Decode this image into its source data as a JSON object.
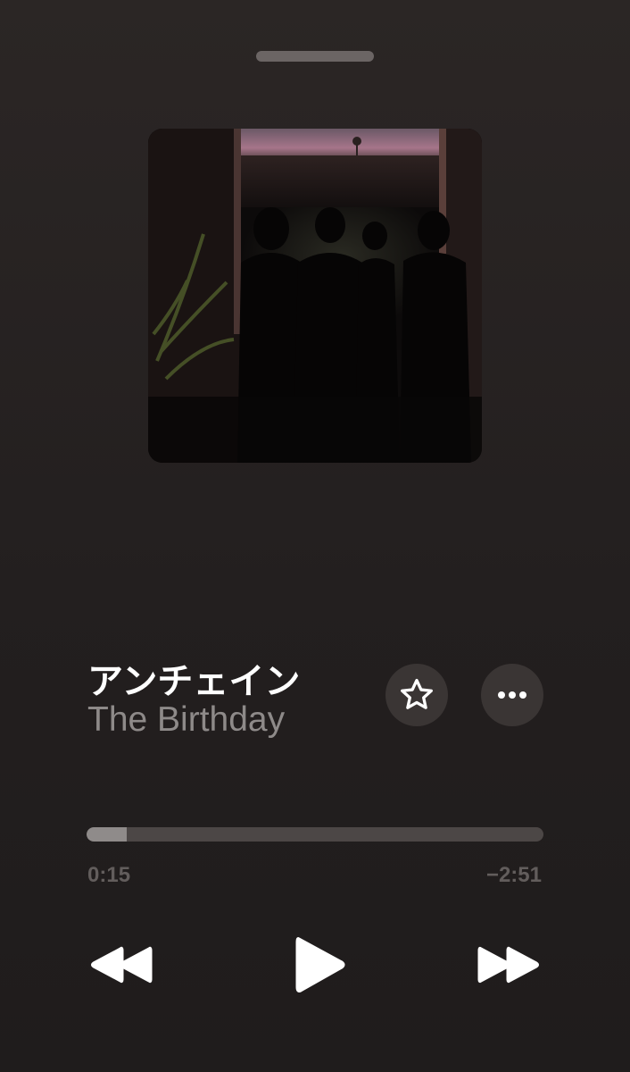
{
  "track": {
    "title": "アンチェイン",
    "artist": "The Birthday"
  },
  "playback": {
    "elapsed": "0:15",
    "remaining": "−2:51",
    "progress_fraction": 0.088,
    "state": "paused"
  },
  "icons": {
    "favorite": "star-outline-icon",
    "more": "ellipsis-icon",
    "previous": "rewind-icon",
    "play": "play-icon",
    "next": "fast-forward-icon"
  },
  "colors": {
    "background": "#2b2625",
    "button_bg": "#3a3534",
    "progress_track": "#4c4746",
    "progress_fill": "#8f8b8a",
    "secondary_text": "#8e8a89"
  }
}
